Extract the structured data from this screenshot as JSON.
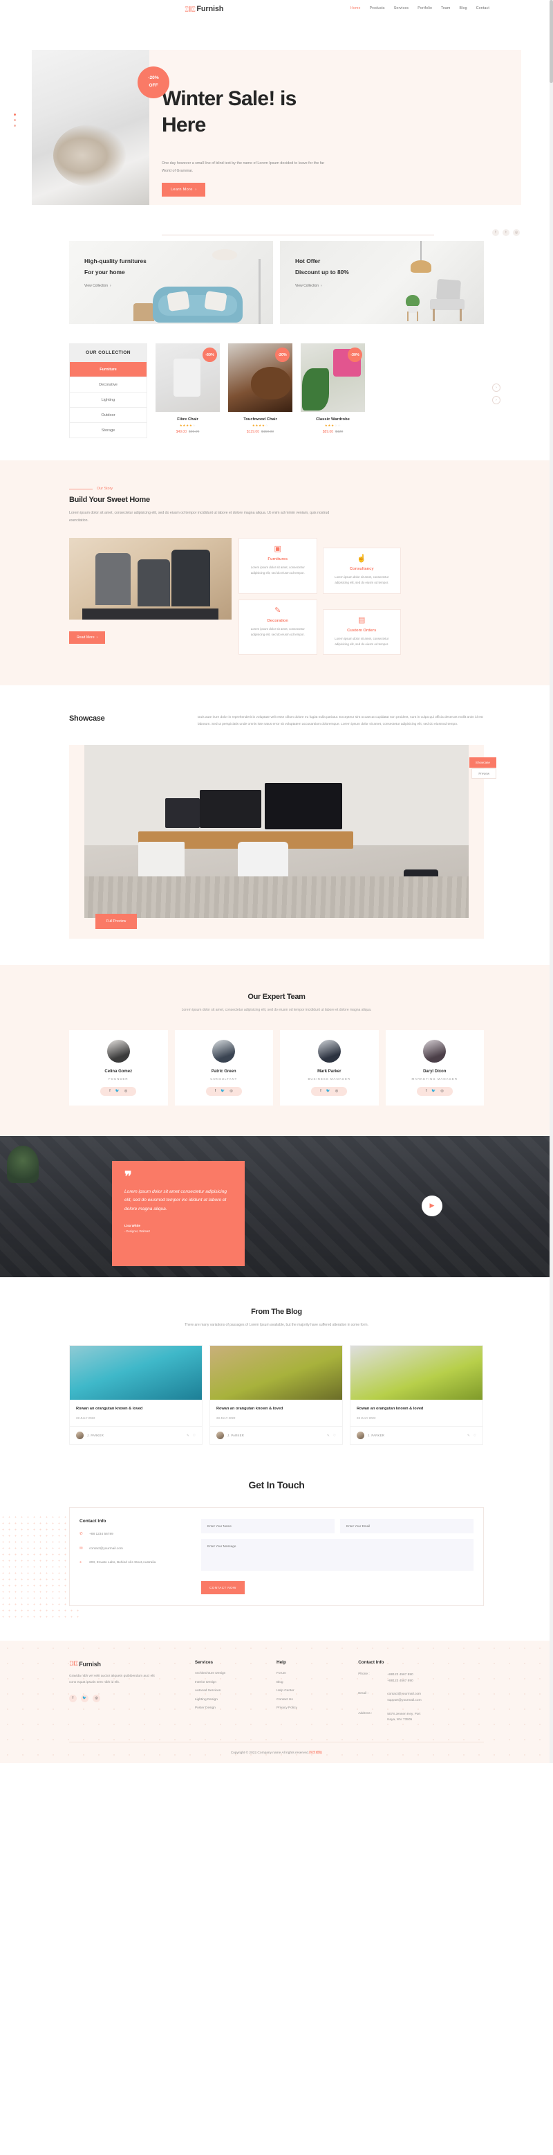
{
  "header": {
    "brand": "Furnish",
    "brand_logo_icon": "furniture-logo-icon",
    "nav": [
      {
        "label": "Home",
        "active": true
      },
      {
        "label": "Products",
        "active": false
      },
      {
        "label": "Services",
        "active": false
      },
      {
        "label": "Portfolio",
        "active": false
      },
      {
        "label": "Team",
        "active": false
      },
      {
        "label": "Blog",
        "active": false
      },
      {
        "label": "Contact",
        "active": false
      }
    ]
  },
  "hero": {
    "badge_line1": "-20%",
    "badge_line2": "OFF",
    "title_part1": "Winter",
    "title_part2": " Sale! is",
    "title_part3": "Here",
    "subtitle": "One day however a small line of blind text by the name of Lorem Ipsum decided to leave for the far World of Grammar.",
    "cta": "Learn More",
    "cta_icon": "chevron-right-icon",
    "socials": [
      "facebook-icon",
      "twitter-icon",
      "instagram-icon"
    ]
  },
  "promos": [
    {
      "title1": "High-quality furnitures",
      "title2": "For your home",
      "link": "View Collection",
      "link_icon": "chevron-right-icon"
    },
    {
      "title1": "Hot Offer",
      "title2": "Discount up to 80%",
      "link": "View Collection",
      "link_icon": "chevron-right-icon"
    }
  ],
  "collection": {
    "menu_title": "OUR COLLECTION",
    "menu": [
      {
        "label": "Furniture",
        "active": true
      },
      {
        "label": "Decorative",
        "active": false
      },
      {
        "label": "Lighting",
        "active": false
      },
      {
        "label": "Outdoor",
        "active": false
      },
      {
        "label": "Storage",
        "active": false
      }
    ],
    "products": [
      {
        "name": "Fibre Chair",
        "badge": "-60%",
        "rating": 4,
        "price": "$49.00",
        "old_price": "$69.00"
      },
      {
        "name": "Touchwood Chair",
        "badge": "-20%",
        "rating": 4,
        "price": "$129.00",
        "old_price": "$159.00"
      },
      {
        "name": "Classic Wardrobe",
        "badge": "-30%",
        "rating": 3,
        "price": "$89.00",
        "old_price": "$129"
      }
    ],
    "arrow_prev_icon": "chevron-up-icon",
    "arrow_next_icon": "chevron-down-icon"
  },
  "story": {
    "eyebrow": "Our Story",
    "title": "Build Your Sweet Home",
    "text": "Lorem ipsum dolor sit amet, consectetur adipisicing elit, sed do eiusm od tempor incididunt ut labore et dolore magna aliqua. Ut enim ad minim veniam, quis nostrud exercitation.",
    "cta": "Read More",
    "cta_icon": "chevron-right-icon",
    "features": [
      {
        "icon": "grid-squares-icon",
        "glyph": "▣",
        "title": "Furnitures",
        "text": "Lorem ipsum dolor sit amet, consectetur adipisicing elit, sed do eiusm od tempor."
      },
      {
        "icon": "hand-coin-icon",
        "glyph": "☝",
        "title": "Consultancy",
        "text": "Lorem ipsum dolor sit amet, consectetur adipisicing elit, sed do eiusm od tempor."
      },
      {
        "icon": "ruler-pencil-icon",
        "glyph": "✎",
        "title": "Decoration",
        "text": "Lorem ipsum dolor sit amet, consectetur adipisicing elit, sed do eiusm od tempor."
      },
      {
        "icon": "chat-question-icon",
        "glyph": "▤",
        "title": "Custom Orders",
        "text": "Lorem ipsum dolor sit amet, consectetur adipisicing elit, sed do eiusm od tempor."
      }
    ]
  },
  "showcase": {
    "title": "Showcase",
    "text": "Duis aute irure dolor in reprehenderit in voluptate velit esse cillum dolore eu fugiat nulla pariatur. Excepteur sint occaecat cupidatat non proident, sunt in culpa qui officia deserunt mollit anim id est laborum. Sed ut perspiciatis unde omnis iste natus error sit voluptatem accusantium doloremque. Lorem ipsum dolor sit amet, consectetur adipisicing elit, sed do eiusmod tempo.",
    "tag": "Showcase",
    "tag2": "Preview",
    "cta": "Full Preview"
  },
  "team": {
    "title": "Our Expert Team",
    "subtitle": "Lorem ipsum dolor sit amet, consectetur adipisicing elit, sed do eiusm od tempor incididunt ut labore et dolore magna aliqua.",
    "members": [
      {
        "name": "Celina Gomez",
        "role": "FOUNDER"
      },
      {
        "name": "Patric Green",
        "role": "CONSULTANT"
      },
      {
        "name": "Mark Parker",
        "role": "BUSINESS MANAGER"
      },
      {
        "name": "Daryl Dixon",
        "role": "MARKETING MANAGER"
      }
    ],
    "social_icons": [
      "facebook-icon",
      "twitter-icon",
      "instagram-icon"
    ]
  },
  "testimonial": {
    "quote_mark": "❞",
    "text": "Lorem ipsum dolor sit amet consectetur adipisicing elit, sed do eiusmod tempor inc ididunt ut labore et dolore magna aliqua.",
    "name": "Lisa White",
    "role": "- Designer, Walmart",
    "play_icon": "play-icon"
  },
  "blog": {
    "title": "From The Blog",
    "subtitle": "There are many variations of passages of Lorem Ipsum available, but the majority have suffered alteration in some form.",
    "posts": [
      {
        "title": "Rowan an orangutan known & loved",
        "date": "28 JULY 2022",
        "author": "J. PARKER",
        "action1_icon": "comment-icon",
        "action2_icon": "heart-icon"
      },
      {
        "title": "Rowan an orangutan known & loved",
        "date": "28 JULY 2022",
        "author": "J. PARKER",
        "action1_icon": "comment-icon",
        "action2_icon": "heart-icon"
      },
      {
        "title": "Rowan an orangutan known & loved",
        "date": "28 JULY 2022",
        "author": "J. PARKER",
        "action1_icon": "comment-icon",
        "action2_icon": "heart-icon"
      }
    ]
  },
  "contact": {
    "title": "Get In Touch",
    "info_title": "Contact Info",
    "phone": "+88 1234 56789",
    "phone_icon": "phone-icon",
    "email": "contact@yourmail.com",
    "email_icon": "envelope-icon",
    "address": "203, Envato Labs, Behind Alis Steet,Australia",
    "address_icon": "location-pin-icon",
    "name_placeholder": "Enter Your Name",
    "email_placeholder": "Enter Your Email",
    "message_placeholder": "Enter Your Message",
    "submit": "CONTACT NOW"
  },
  "footer": {
    "brand": "Furnish",
    "about": "Gravida nibh vel velit auctor aliquetn quibibendum auci elit cons equat ipsutis sem nibh id elit.",
    "socials": [
      "facebook-icon",
      "twitter-icon",
      "instagram-icon"
    ],
    "services": {
      "title": "Services",
      "items": [
        "Architechture Design",
        "Interior Design",
        "Autocad Services",
        "Lighting Design",
        "Poster Design"
      ]
    },
    "help": {
      "title": "Help",
      "items": [
        "Forum",
        "Blog",
        "Help Center",
        "Contact Us",
        "Privacy Policy"
      ]
    },
    "contact": {
      "title": "Contact Info",
      "phone_key": "Phone :",
      "phone1": "+88123 4567 890",
      "phone2": "+88123 4567 890",
      "email_key": "Email :",
      "email1": "contact@yourmail.com",
      "email2": "support@yourmail.com",
      "address_key": "Address :",
      "address1": "5078 Jensen Key, Port",
      "address2": "Kaya, WV 73505"
    },
    "copyright": "Copyright © 2022.Company name All rights reserved.",
    "copyright_suffix": "网页模板"
  },
  "colors": {
    "accent": "#fa7a66",
    "cream": "#fdf4ef",
    "dark": "#2a2a2a",
    "muted": "#8e8e8e"
  }
}
